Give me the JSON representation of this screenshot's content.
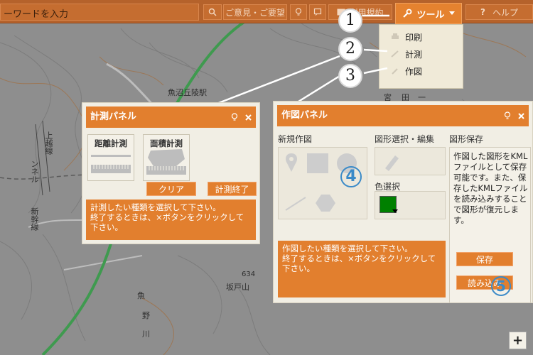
{
  "topbar": {
    "search_placeholder": "ーワードを入力",
    "feedback_label": "ご意見・ご要望",
    "terms_label": "利用規約",
    "tool_label": "ツール",
    "help_label": "ヘルプ"
  },
  "tool_menu": {
    "items": [
      {
        "label": "印刷",
        "icon": "print-icon"
      },
      {
        "label": "計測",
        "icon": "ruler-icon"
      },
      {
        "label": "作図",
        "icon": "pencil-icon"
      }
    ]
  },
  "callouts": [
    "1",
    "2",
    "3",
    "4",
    "5"
  ],
  "map": {
    "labels": [
      "魚沼丘陵駅",
      "上越線",
      "ンネル",
      "新幹線",
      "魚",
      "野",
      "川",
      "634",
      "坂戸山",
      "宮",
      "田",
      "一"
    ]
  },
  "measure_panel": {
    "title": "計測パネル",
    "distance_label": "距離計測",
    "area_label": "面積計測",
    "clear_label": "クリア",
    "end_label": "計測終了",
    "instruction_line1": "計測したい種類を選択して下さい。",
    "instruction_line2": "終了するときは、×ボタンをクリックして下さい。"
  },
  "draw_panel": {
    "title": "作図パネル",
    "new_drawing_title": "新規作図",
    "select_edit_title": "図形選択・編集",
    "color_title": "色選択",
    "save_title": "図形保存",
    "save_description": "作図した図形をKMLファイルとして保存可能です。また、保存したKMLファイルを読み込みすることで図形が復元します。",
    "save_button": "保存",
    "load_button": "読み込み",
    "instruction_line1": "作図したい種類を選択して下さい。",
    "instruction_line2": "終了するときは、×ボタンをクリックして下さい。",
    "selected_color": "#008000"
  },
  "zoom_in_label": "+",
  "colors": {
    "accent": "#e27f2e",
    "topbar": "#b5622b",
    "panel_bg": "#f1eee4"
  }
}
